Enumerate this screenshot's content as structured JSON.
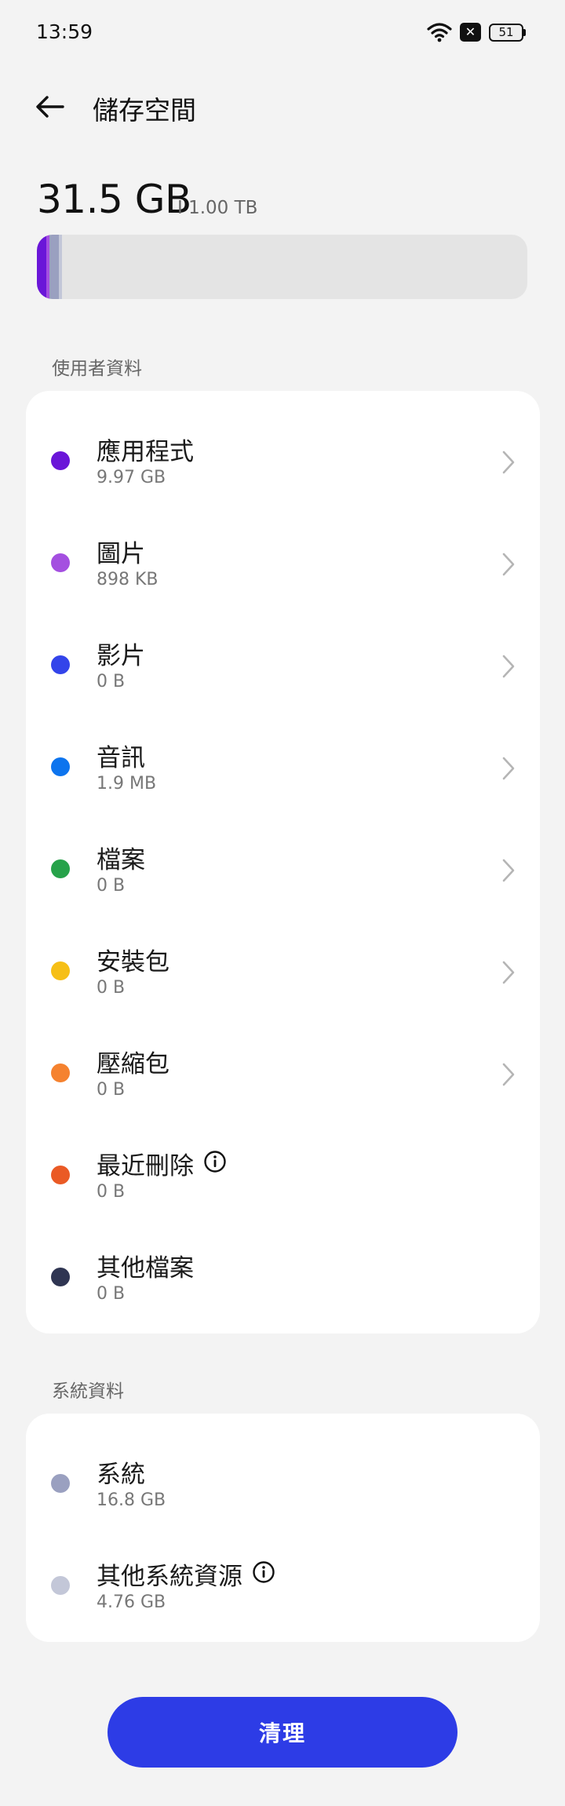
{
  "status_bar": {
    "time": "13:59",
    "battery_level": "51",
    "icons": [
      "wifi-icon",
      "no-sim-icon",
      "battery-icon"
    ]
  },
  "header": {
    "title": "儲存空間",
    "back_icon": "arrow-left-icon"
  },
  "summary": {
    "used": "31.5 GB",
    "total": "I 1.00 TB",
    "bar_segments": [
      {
        "name": "應用程式",
        "color": "#6a16d8"
      },
      {
        "name": "圖片",
        "color": "#a44fe0"
      },
      {
        "name": "系統",
        "color": "#9aa0c0"
      },
      {
        "name": "其他系統資源",
        "color": "#c3c7d8"
      }
    ]
  },
  "user_section": {
    "label": "使用者資料",
    "items": [
      {
        "title": "應用程式",
        "size": "9.97 GB",
        "color": "#6a16d8",
        "has_chevron": true
      },
      {
        "title": "圖片",
        "size": "898 KB",
        "color": "#a44fe0",
        "has_chevron": true
      },
      {
        "title": "影片",
        "size": "0 B",
        "color": "#3344ea",
        "has_chevron": true
      },
      {
        "title": "音訊",
        "size": "1.9 MB",
        "color": "#0d74ee",
        "has_chevron": true
      },
      {
        "title": "檔案",
        "size": "0 B",
        "color": "#27a24a",
        "has_chevron": true
      },
      {
        "title": "安裝包",
        "size": "0 B",
        "color": "#f6bf16",
        "has_chevron": true
      },
      {
        "title": "壓縮包",
        "size": "0 B",
        "color": "#f5822f",
        "has_chevron": true
      },
      {
        "title": "最近刪除",
        "size": "0 B",
        "color": "#ea5a25",
        "has_info": true
      },
      {
        "title": "其他檔案",
        "size": "0 B",
        "color": "#2f3552"
      }
    ]
  },
  "system_section": {
    "label": "系統資料",
    "items": [
      {
        "title": "系統",
        "size": "16.8 GB",
        "color": "#9aa0c0"
      },
      {
        "title": "其他系統資源",
        "size": "4.76 GB",
        "color": "#c3c7d8",
        "has_info": true
      }
    ]
  },
  "clean_button": {
    "label": "清理"
  }
}
